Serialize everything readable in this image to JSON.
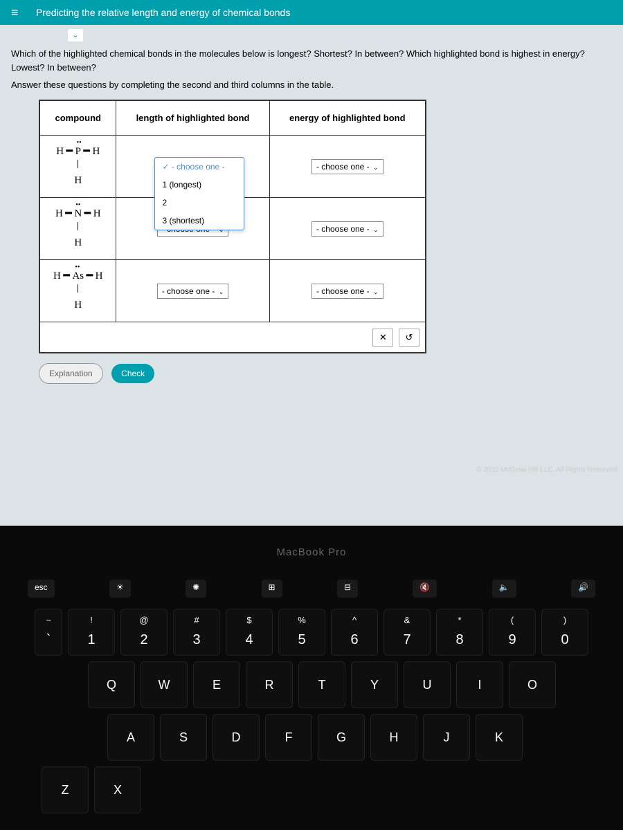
{
  "header": {
    "title": "Predicting the relative length and energy of chemical bonds"
  },
  "question": "Which of the highlighted chemical bonds in the molecules below is longest? Shortest? In between? Which highlighted bond is highest in energy? Lowest? In between?",
  "instruction": "Answer these questions by completing the second and third columns in the table.",
  "table": {
    "headers": {
      "compound": "compound",
      "length": "length of highlighted bond",
      "energy": "energy of highlighted bond"
    },
    "placeholder": "- choose one -",
    "openLabel": "✓ - choose one -",
    "options": {
      "opt1": "1 (longest)",
      "opt2": "2",
      "opt3": "3 (shortest)"
    },
    "rows": [
      {
        "compound_center": "P",
        "compound_bottom": "H"
      },
      {
        "compound_center": "N",
        "compound_bottom": "H"
      },
      {
        "compound_center": "As",
        "compound_bottom": "H"
      }
    ]
  },
  "tools": {
    "close": "✕",
    "reset": "↺"
  },
  "buttons": {
    "explanation": "Explanation",
    "check": "Check"
  },
  "copyright": "© 2022 McGraw Hill LLC. All Rights Reserved.",
  "laptop": "MacBook Pro",
  "touchbar": {
    "esc": "esc",
    "brightDown": "☀",
    "brightUp": "✺",
    "mission": "⊞",
    "launch": "⊟",
    "mute": "🔇",
    "volDown": "🔈",
    "volUp": "🔊"
  },
  "keys": {
    "row1": [
      {
        "upper": "!",
        "lower": "1"
      },
      {
        "upper": "@",
        "lower": "2"
      },
      {
        "upper": "#",
        "lower": "3"
      },
      {
        "upper": "$",
        "lower": "4"
      },
      {
        "upper": "%",
        "lower": "5"
      },
      {
        "upper": "^",
        "lower": "6"
      },
      {
        "upper": "&",
        "lower": "7"
      },
      {
        "upper": "*",
        "lower": "8"
      },
      {
        "upper": "(",
        "lower": "9"
      },
      {
        "upper": ")",
        "lower": "0"
      }
    ],
    "row2": [
      "Q",
      "W",
      "E",
      "R",
      "T",
      "Y",
      "U",
      "I",
      "O"
    ],
    "row3": [
      "A",
      "S",
      "D",
      "F",
      "G",
      "H",
      "J",
      "K"
    ],
    "row4": [
      "Z",
      "X"
    ]
  },
  "tilde": {
    "upper": "~",
    "lower": "`"
  }
}
